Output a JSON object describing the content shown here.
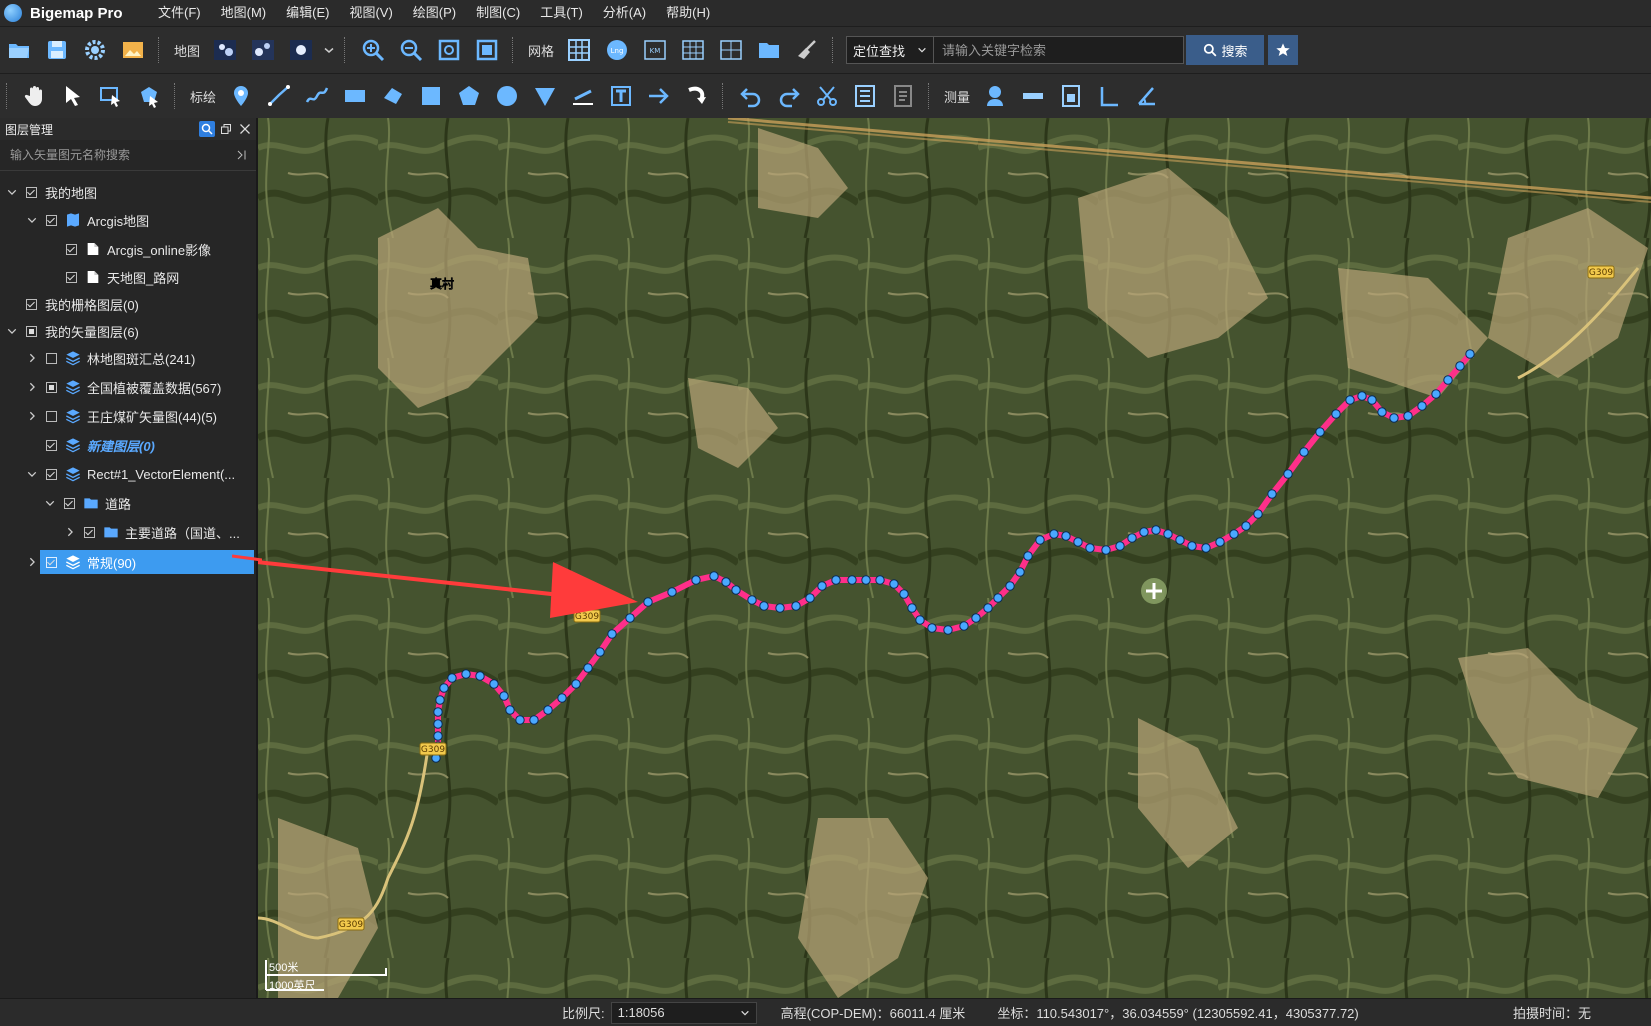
{
  "app": {
    "title": "Bigemap Pro"
  },
  "menu": [
    "文件(F)",
    "地图(M)",
    "编辑(E)",
    "视图(V)",
    "绘图(P)",
    "制图(C)",
    "工具(T)",
    "分析(A)",
    "帮助(H)"
  ],
  "toolbar1": {
    "map_label": "地图",
    "grid_label": "网格",
    "locate_select": "定位查找",
    "search_placeholder": "请输入关键字检索",
    "search_button": "搜索"
  },
  "toolbar2": {
    "draw_label": "标绘",
    "measure_label": "测量"
  },
  "layer_panel": {
    "title": "图层管理",
    "search_placeholder": "输入矢量图元名称搜索",
    "items": [
      {
        "label": "我的地图"
      },
      {
        "label": "Arcgis地图"
      },
      {
        "label": "Arcgis_online影像"
      },
      {
        "label": "天地图_路网"
      },
      {
        "label": "我的栅格图层(0)"
      },
      {
        "label": "我的矢量图层(6)"
      },
      {
        "label": "林地图斑汇总(241)"
      },
      {
        "label": "全国植被覆盖数据(567)"
      },
      {
        "label": "王庄煤矿矢量图(44)(5)"
      },
      {
        "label": "新建图层(0)"
      },
      {
        "label": "Rect#1_VectorElement(..."
      },
      {
        "label": "道路"
      },
      {
        "label": "主要道路（国道、..."
      },
      {
        "label": "常规(90)"
      }
    ]
  },
  "map": {
    "village_label": "真村",
    "road_labels": [
      "G309",
      "G309",
      "G309",
      "G309"
    ],
    "scale_bar": {
      "metric": "500米",
      "imperial": "1000英尺"
    },
    "route_color": "#ff2f8a",
    "vertex_color": "#4aa8ff",
    "arrow_color": "#ff3b3b"
  },
  "status": {
    "scale_label": "比例尺:",
    "scale_value": "1:18056",
    "elevation": "高程(COP-DEM)：66011.4 厘米",
    "coordinates": "坐标：110.543017°，36.034559°  (12305592.41，4305377.72)",
    "capture_time": "拍摄时间：无"
  }
}
